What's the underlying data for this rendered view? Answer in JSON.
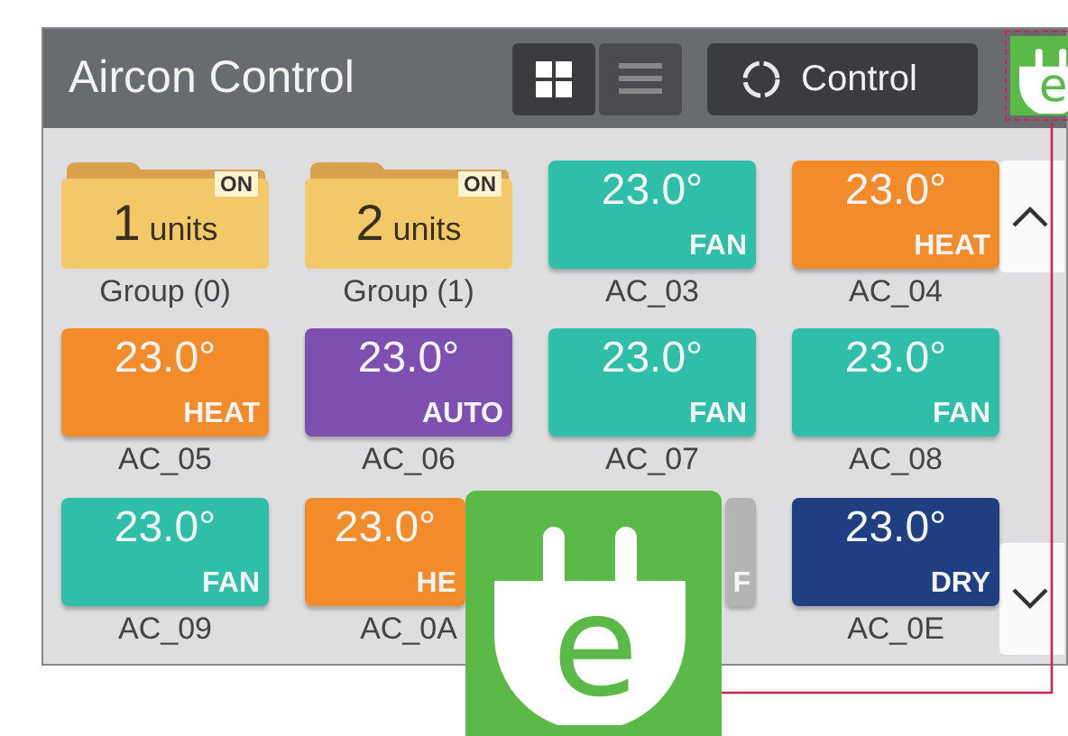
{
  "header": {
    "title": "Aircon Control",
    "view_buttons": [
      {
        "kind": "grid",
        "selected": true
      },
      {
        "kind": "list",
        "selected": false
      }
    ],
    "control_button": "Control"
  },
  "tiles": [
    {
      "kind": "group",
      "count": "1",
      "unit": "units",
      "badge": "ON",
      "name": "Group (0)"
    },
    {
      "kind": "group",
      "count": "2",
      "unit": "units",
      "badge": "ON",
      "name": "Group (1)"
    },
    {
      "kind": "device",
      "temp": "23.0°",
      "mode": "FAN",
      "color": "#2fbfa9",
      "name": "AC_03"
    },
    {
      "kind": "device",
      "temp": "23.0°",
      "mode": "HEAT",
      "color": "#f28b2a",
      "name": "AC_04"
    },
    {
      "kind": "device",
      "temp": "23.0°",
      "mode": "HEAT",
      "color": "#f28b2a",
      "name": "AC_05"
    },
    {
      "kind": "device",
      "temp": "23.0°",
      "mode": "AUTO",
      "color": "#7c4fb0",
      "name": "AC_06"
    },
    {
      "kind": "device",
      "temp": "23.0°",
      "mode": "FAN",
      "color": "#2fbfa9",
      "name": "AC_07"
    },
    {
      "kind": "device",
      "temp": "23.0°",
      "mode": "FAN",
      "color": "#2fbfa9",
      "name": "AC_08"
    },
    {
      "kind": "device",
      "temp": "23.0°",
      "mode": "FAN",
      "color": "#2fbfa9",
      "name": "AC_09"
    },
    {
      "kind": "device_cut_right",
      "temp": "23.0°",
      "mode": "HE",
      "color": "#f28b2a",
      "name": "AC_0A"
    },
    {
      "kind": "device_cut_left",
      "mode": "F",
      "color": "#b4b4b4"
    },
    {
      "kind": "device",
      "temp": "23.0°",
      "mode": "DRY",
      "color": "#1f3f82",
      "name": "AC_0E"
    }
  ],
  "badge_logo": {
    "letter": "e"
  },
  "callout_logo": {
    "letter": "e"
  }
}
